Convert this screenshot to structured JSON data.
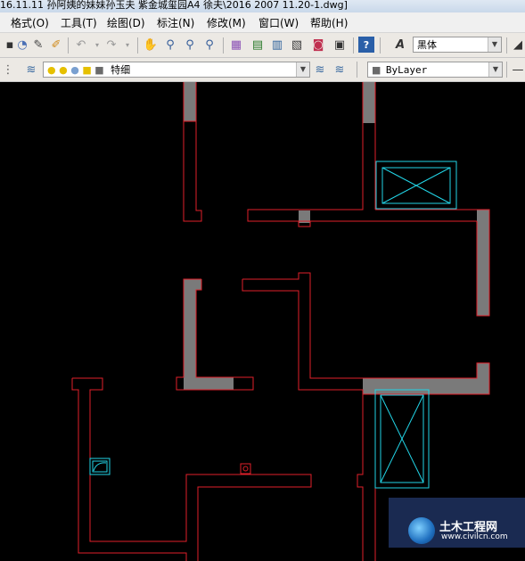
{
  "window": {
    "title": "16.11.11 孙阿姨的妹妹孙玉夫 紫金城玺园A4 徐夫\\2016 2007 11.20-1.dwg]"
  },
  "menu": {
    "items": [
      {
        "label": "格式(O)"
      },
      {
        "label": "工具(T)"
      },
      {
        "label": "绘图(D)"
      },
      {
        "label": "标注(N)"
      },
      {
        "label": "修改(M)"
      },
      {
        "label": "窗口(W)"
      },
      {
        "label": "帮助(H)"
      }
    ]
  },
  "toolbar1": {
    "text_style_value": "黑体"
  },
  "toolbar2": {
    "layer_value": "特细",
    "color_value": "ByLayer"
  },
  "watermark": {
    "title": "土木工程网",
    "url": "www.civilcn.com"
  },
  "colors": {
    "wall_outline": "#e0202a",
    "wall_fill": "#7a7a7a",
    "cyan": "#22d4e6",
    "background": "#000000"
  }
}
